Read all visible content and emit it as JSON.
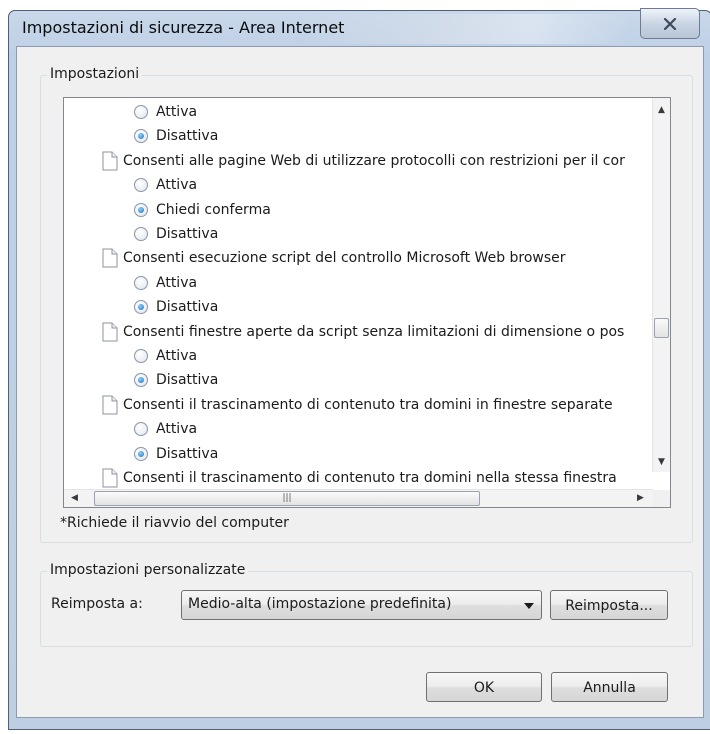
{
  "window": {
    "title": "Impostazioni di sicurezza - Area Internet",
    "close_icon": "close-icon"
  },
  "settings_group": {
    "title": "Impostazioni",
    "rows": [
      {
        "kind": "radio",
        "label": "Attiva",
        "selected": false
      },
      {
        "kind": "radio",
        "label": "Disattiva",
        "selected": true
      },
      {
        "kind": "header",
        "label": "Consenti alle pagine Web di utilizzare protocolli con restrizioni per il cor"
      },
      {
        "kind": "radio",
        "label": "Attiva",
        "selected": false
      },
      {
        "kind": "radio",
        "label": "Chiedi conferma",
        "selected": true
      },
      {
        "kind": "radio",
        "label": "Disattiva",
        "selected": false
      },
      {
        "kind": "header",
        "label": "Consenti esecuzione script del controllo Microsoft Web browser"
      },
      {
        "kind": "radio",
        "label": "Attiva",
        "selected": false
      },
      {
        "kind": "radio",
        "label": "Disattiva",
        "selected": true
      },
      {
        "kind": "header",
        "label": "Consenti finestre aperte da script senza limitazioni di dimensione o pos"
      },
      {
        "kind": "radio",
        "label": "Attiva",
        "selected": false
      },
      {
        "kind": "radio",
        "label": "Disattiva",
        "selected": true
      },
      {
        "kind": "header",
        "label": "Consenti il trascinamento di contenuto tra domini in finestre separate"
      },
      {
        "kind": "radio",
        "label": "Attiva",
        "selected": false
      },
      {
        "kind": "radio",
        "label": "Disattiva",
        "selected": true
      },
      {
        "kind": "header",
        "label": "Consenti il trascinamento di contenuto tra domini nella stessa finestra"
      }
    ],
    "footnote": "*Richiede il riavvio del computer",
    "scroll_position": 0.63
  },
  "custom_group": {
    "title": "Impostazioni personalizzate",
    "reset_label": "Reimposta a:",
    "reset_value": "Medio-alta (impostazione predefinita)",
    "reset_button": "Reimposta..."
  },
  "buttons": {
    "ok": "OK",
    "cancel": "Annulla"
  },
  "colors": {
    "titlebar": "#bfcfe3",
    "dialog_bg": "#f0f0f0",
    "radio_selected": "#1a6fc4"
  }
}
